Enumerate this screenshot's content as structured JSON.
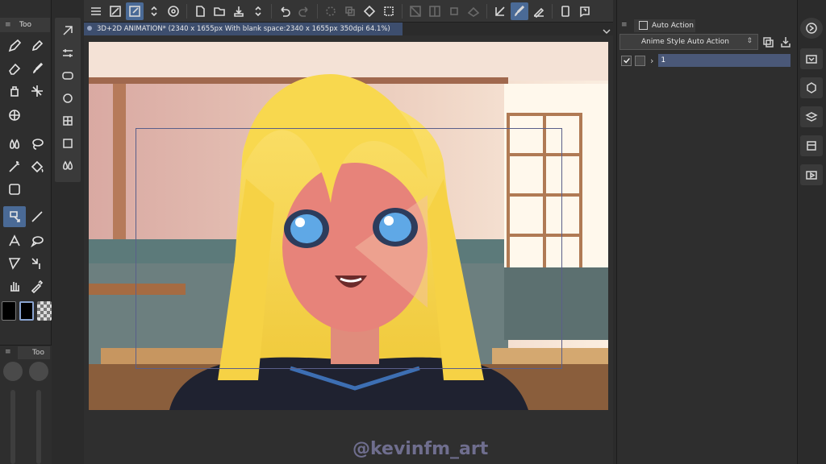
{
  "left_panel": {
    "tab_label": "Too"
  },
  "brush_panel": {
    "tab_label": "Too"
  },
  "document": {
    "tab_title": "3D+2D ANIMATION* (2340 x 1655px With blank space:2340 x 1655px 350dpi 64.1%)"
  },
  "auto_action": {
    "tab_label": "Auto Action",
    "set_name": "Anime Style Auto Action",
    "items": [
      {
        "label": "1",
        "checked": true
      }
    ]
  },
  "watermark": "@kevinfm_art",
  "colors": {
    "accent": "#4a6a96",
    "main_color": "#000000",
    "sub_color": "#000000"
  }
}
